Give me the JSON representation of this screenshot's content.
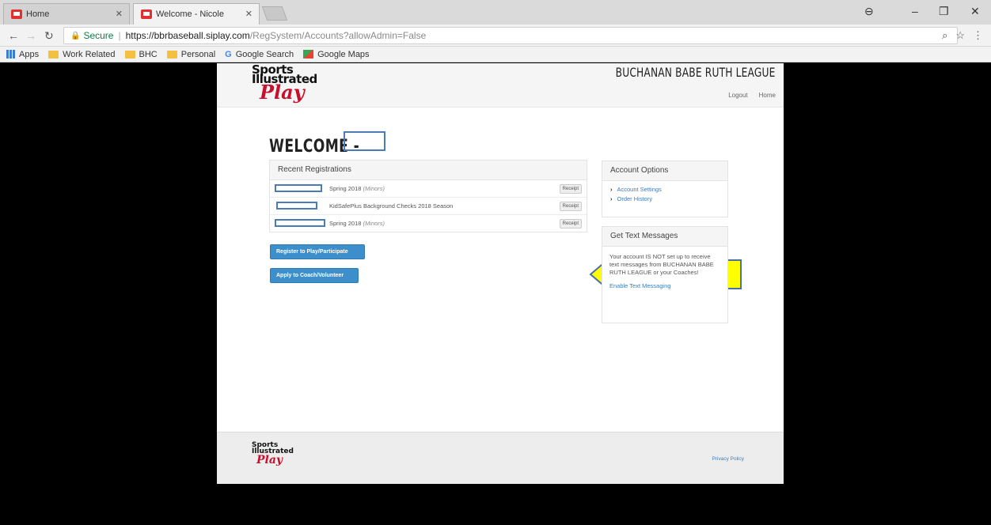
{
  "browser": {
    "tabs": [
      {
        "title": "Home",
        "active": false
      },
      {
        "title": "Welcome - Nicole",
        "active": true
      }
    ],
    "url_secure": "Secure",
    "url_host": "https://bbrbaseball.siplay.com",
    "url_path": "/RegSystem/Accounts?allowAdmin=False",
    "bookmarks": [
      "Apps",
      "Work Related",
      "BHC",
      "Personal",
      "Google Search",
      "Google Maps"
    ]
  },
  "site": {
    "logo_line1": "Sports",
    "logo_line2": "Illustrated",
    "logo_line3": "Play",
    "league_name": "BUCHANAN BABE RUTH LEAGUE",
    "nav": {
      "logout": "Logout",
      "home": "Home"
    },
    "welcome": "WELCOME -"
  },
  "recent_registrations": {
    "heading": "Recent Registrations",
    "rows": [
      {
        "title": "Spring 2018",
        "division": "(Minors)",
        "button": "Receipt"
      },
      {
        "title": "KidSafePlus Background Checks 2018 Season",
        "division": "",
        "button": "Receipt"
      },
      {
        "title": "Spring 2018",
        "division": "(Minors)",
        "button": "Receipt"
      }
    ]
  },
  "buttons": {
    "register": "Register to Play/Participate",
    "coach": "Apply to Coach/Volunteer"
  },
  "account_options": {
    "heading": "Account Options",
    "items": [
      "Account Settings",
      "Order History"
    ]
  },
  "text_messages": {
    "heading": "Get Text Messages",
    "body": "Your account IS NOT set up to receive text messages from BUCHANAN BABE RUTH LEAGUE or your Coaches!",
    "link": "Enable Text Messaging"
  },
  "footer": {
    "privacy": "Privacy Policy"
  },
  "colors": {
    "accent_button": "#3d8fcb",
    "link": "#3d7db8",
    "arrow_fill": "#ffff00"
  }
}
